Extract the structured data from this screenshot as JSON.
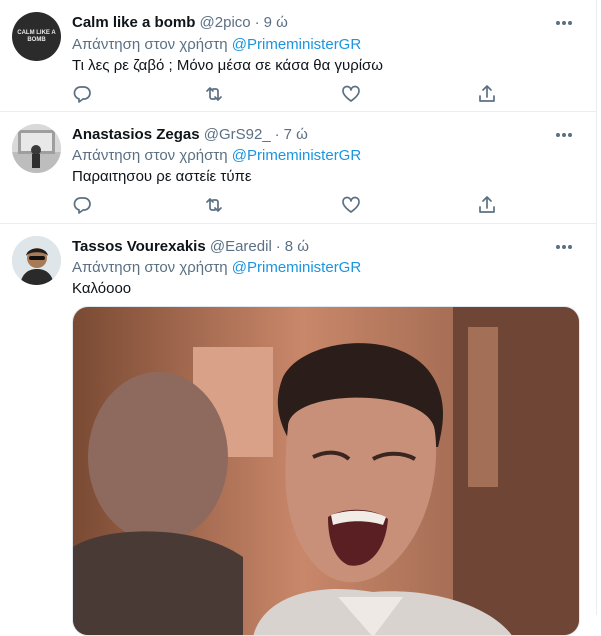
{
  "tweets": [
    {
      "name": "Calm like a bomb",
      "handle": "@2pico",
      "time": "9 ώ",
      "reply_prefix": "Απάντηση στον χρήστη",
      "reply_mention": "@PrimeministerGR",
      "text": "Τι λες ρε ζαβό ; Μόνο μέσα σε κάσα θα γυρίσω",
      "avatar_text": "CALM LIKE A BOMB"
    },
    {
      "name": "Anastasios Zegas",
      "handle": "@GrS92_",
      "time": "7 ώ",
      "reply_prefix": "Απάντηση στον χρήστη",
      "reply_mention": "@PrimeministerGR",
      "text": "Παραιτησου ρε αστείε τύπε"
    },
    {
      "name": "Tassos Vourexakis",
      "handle": "@Earedil",
      "time": "8 ώ",
      "reply_prefix": "Απάντηση στον χρήστη",
      "reply_mention": "@PrimeministerGR",
      "text": "Καλόοοο"
    }
  ],
  "separator": "·",
  "colors": {
    "secondary_text": "#5b7083",
    "mention": "#1b95e0",
    "border": "#ebeef0"
  },
  "icons": [
    "more-icon",
    "reply-icon",
    "retweet-icon",
    "like-icon",
    "share-icon"
  ]
}
